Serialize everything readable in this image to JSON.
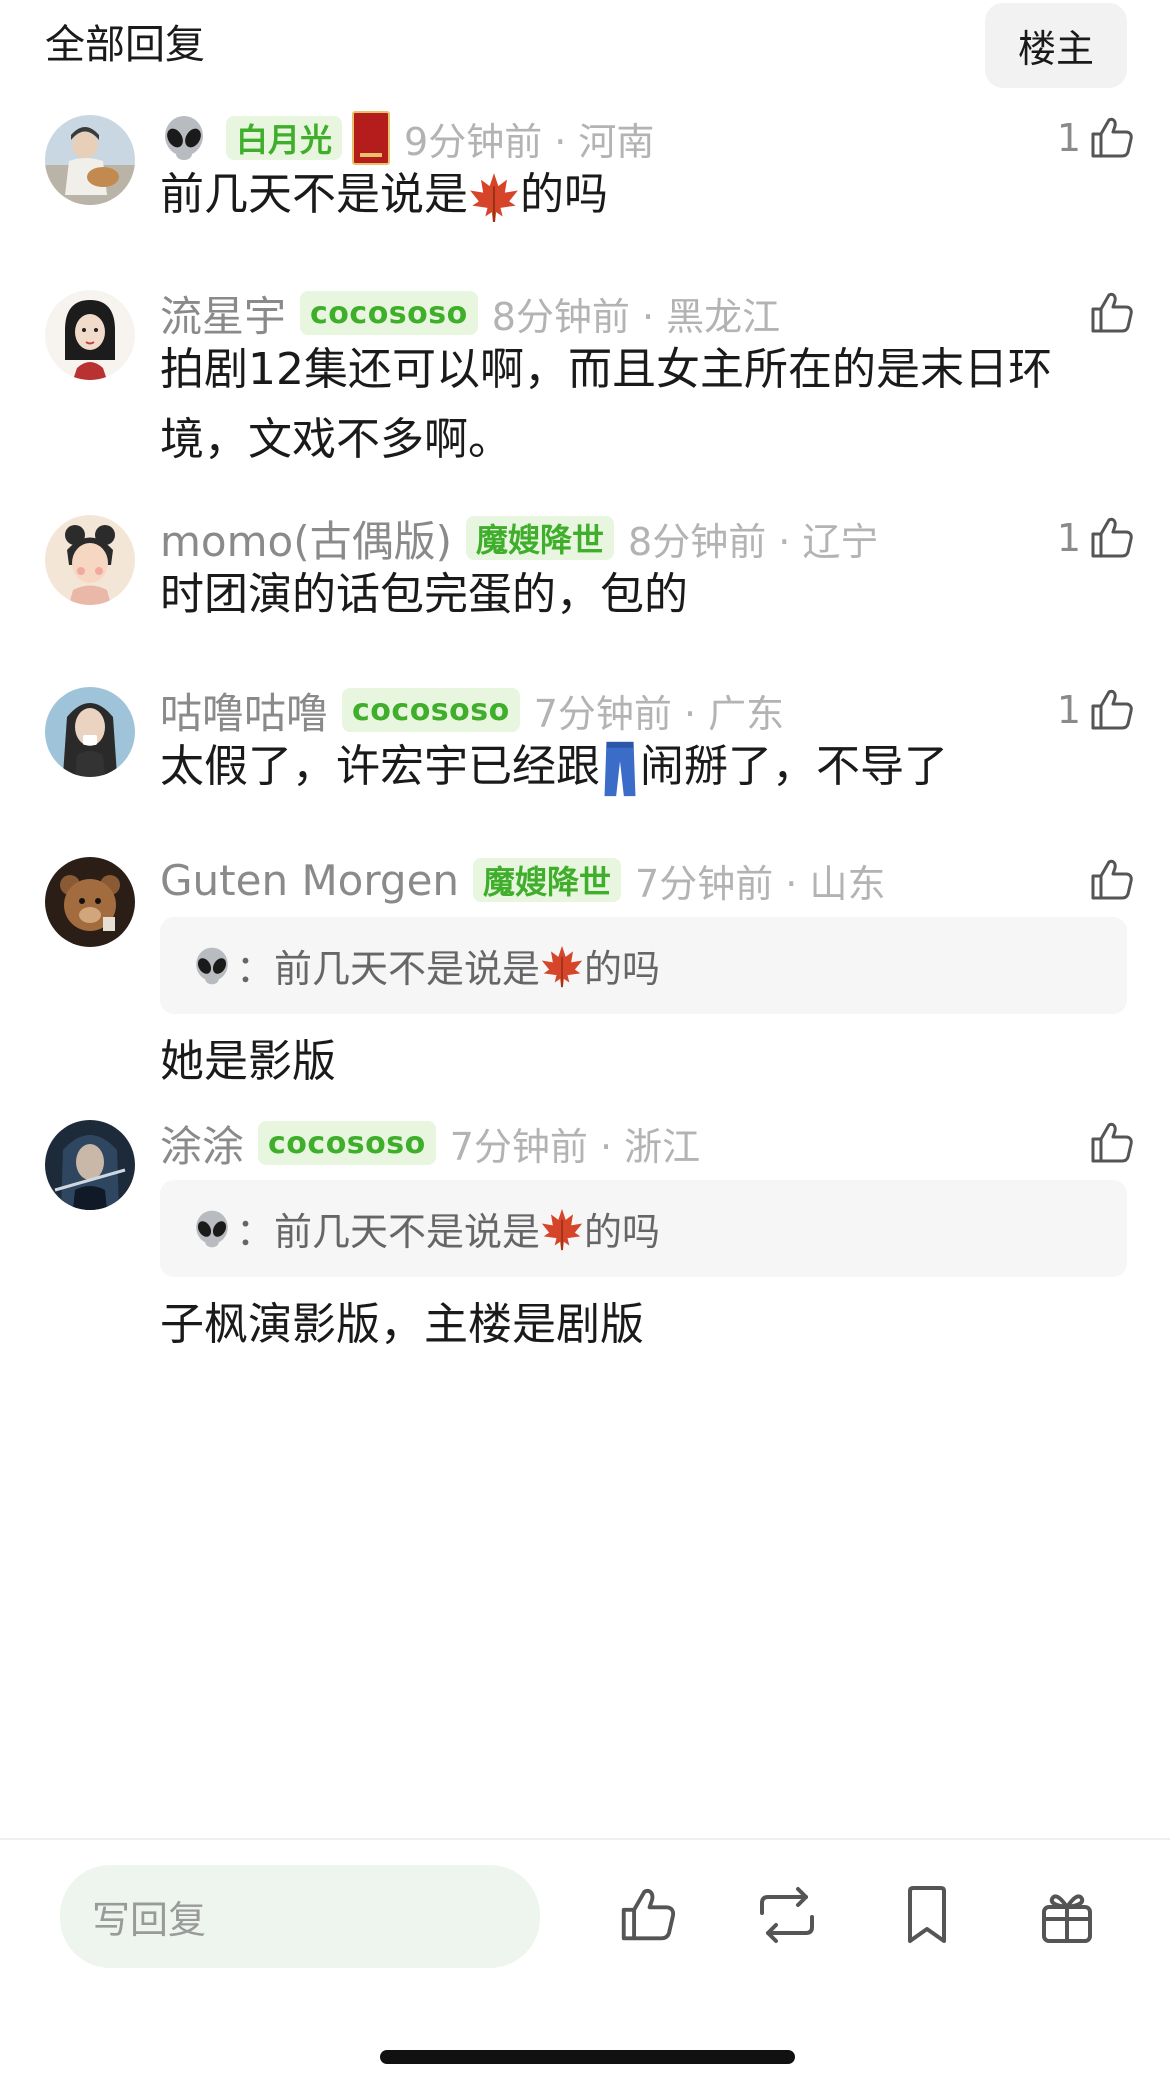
{
  "header": {
    "title": "全部回复",
    "owner_button": "楼主"
  },
  "comments": [
    {
      "avatar_icon": "avatar-girl-guitar",
      "username_icon": "alien-emoji",
      "badge": "白月光",
      "extra_badge_icon": "red-book-icon",
      "time": "9分钟前 · 河南",
      "likes": "1",
      "text_before": "前几天不是说是",
      "text_emoji": "maple-leaf-emoji",
      "text_after": "的吗"
    },
    {
      "avatar_icon": "avatar-girl-sketch",
      "username": "流星宇",
      "badge": "cocososo",
      "time": "8分钟前 · 黑龙江",
      "likes": "",
      "text": "拍剧12集还可以啊，而且女主所在的是末日环境，文戏不多啊。"
    },
    {
      "avatar_icon": "avatar-ancient-girl",
      "username": "momo(古偶版)",
      "badge": "魔嫂降世",
      "time": "8分钟前 · 辽宁",
      "likes": "1",
      "text": "时团演的话包完蛋的，包的"
    },
    {
      "avatar_icon": "avatar-long-hair-man",
      "username": "咕噜咕噜",
      "badge": "cocososo",
      "time": "7分钟前 · 广东",
      "likes": "1",
      "text_before": "太假了，许宏宇已经跟",
      "text_emoji": "jeans-emoji",
      "text_after": "闹掰了，不导了"
    },
    {
      "avatar_icon": "avatar-teddy-bear",
      "username": "Guten Morgen",
      "badge": "魔嫂降世",
      "time": "7分钟前 · 山东",
      "likes": "",
      "quote_sep": "：",
      "quote_before": "前几天不是说是",
      "quote_after": "的吗",
      "text": "她是影版"
    },
    {
      "avatar_icon": "avatar-dark-warrior",
      "username": "涂涂",
      "badge": "cocososo",
      "time": "7分钟前 · 浙江",
      "likes": "",
      "quote_sep": "：",
      "quote_before": "前几天不是说是",
      "quote_after": "的吗",
      "text": "子枫演影版，主楼是剧版"
    }
  ],
  "bottom_bar": {
    "reply_placeholder": "写回复",
    "actions": [
      "thumb-up-icon",
      "repost-icon",
      "bookmark-icon",
      "gift-icon"
    ]
  },
  "colors": {
    "badge_bg": "#e8f6e0",
    "badge_text": "#3fae2a",
    "reply_input_bg": "#eef5ee",
    "meta_gray": "#b3b3b3"
  }
}
